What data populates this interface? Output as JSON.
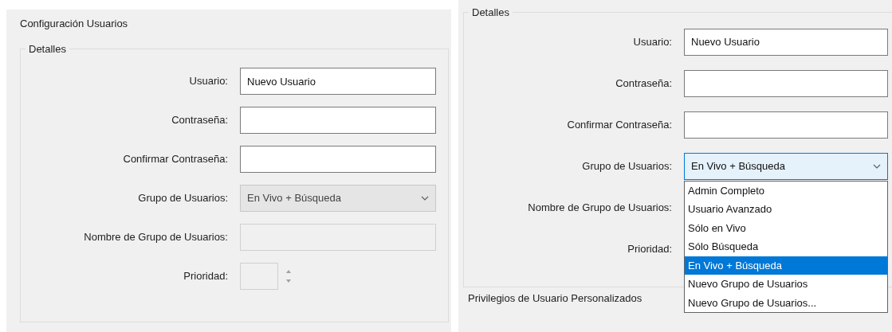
{
  "left_panel": {
    "title": "Configuración Usuarios",
    "group_title": "Detalles",
    "fields": [
      {
        "label": "Usuario:",
        "kind": "text",
        "value": "Nuevo Usuario",
        "disabled": false
      },
      {
        "label": "Contraseña:",
        "kind": "text",
        "disabled": false
      },
      {
        "label": "Confirmar Contraseña:",
        "kind": "text",
        "disabled": false
      },
      {
        "label": "Grupo de Usuarios:",
        "kind": "combo",
        "value": "En Vivo + Búsqueda",
        "disabled": true
      },
      {
        "label": "Nombre de Grupo de Usuarios:",
        "kind": "text",
        "disabled": true
      },
      {
        "label": "Prioridad:",
        "kind": "spin",
        "disabled": true
      }
    ]
  },
  "right_panel": {
    "group_title": "Detalles",
    "fields": [
      {
        "label": "Usuario:",
        "kind": "text",
        "value": "Nuevo Usuario",
        "disabled": false
      },
      {
        "label": "Contraseña:",
        "kind": "text",
        "disabled": false
      },
      {
        "label": "Confirmar Contraseña:",
        "kind": "text",
        "disabled": false
      },
      {
        "label": "Grupo de Usuarios:",
        "kind": "combo",
        "value": "En Vivo + Búsqueda",
        "disabled": false,
        "expanded": true,
        "options": [
          {
            "label": "Admin Completo",
            "selected": false
          },
          {
            "label": "Usuario Avanzado",
            "selected": false
          },
          {
            "label": "Sólo en Vivo",
            "selected": false
          },
          {
            "label": "Sólo Búsqueda",
            "selected": false
          },
          {
            "label": "En Vivo + Búsqueda",
            "selected": true
          },
          {
            "label": "Nuevo Grupo de Usuarios",
            "selected": false
          },
          {
            "label": "Nuevo Grupo de Usuarios...",
            "selected": false
          }
        ]
      },
      {
        "label": "Nombre de Grupo de Usuarios:",
        "kind": "none"
      },
      {
        "label": "Prioridad:",
        "kind": "none"
      }
    ],
    "section_title": "Privilegios de Usuario Personalizados"
  }
}
